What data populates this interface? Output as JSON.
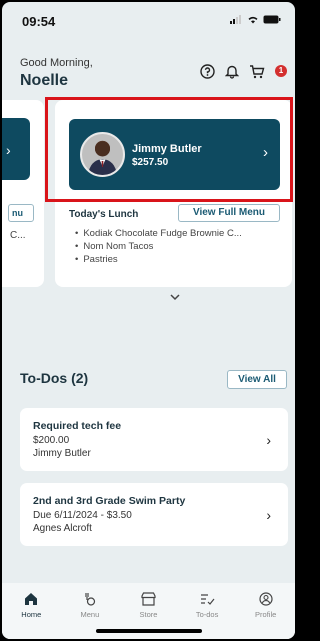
{
  "status": {
    "time": "09:54"
  },
  "header": {
    "greeting": "Good Morning,",
    "user_name": "Noelle",
    "cart_count": "1"
  },
  "side_card": {
    "menu_label": "nu",
    "lunch_preview": "C..."
  },
  "student": {
    "name": "Jimmy Butler",
    "balance": "$257.50"
  },
  "lunch": {
    "title": "Today's Lunch",
    "view_full_label": "View Full Menu",
    "items": [
      "Kodiak Chocolate Fudge Brownie C...",
      "Nom Nom Tacos",
      "Pastries"
    ]
  },
  "todos": {
    "title": "To-Dos (2)",
    "view_all_label": "View All",
    "items": [
      {
        "title": "Required tech fee",
        "line2": "$200.00",
        "line3": "Jimmy Butler"
      },
      {
        "title": "2nd and 3rd Grade Swim Party",
        "line2": "Due 6/11/2024 - $3.50",
        "line3": "Agnes Alcroft"
      }
    ]
  },
  "tabs": [
    {
      "label": "Home",
      "icon": "home-icon"
    },
    {
      "label": "Menu",
      "icon": "menu-icon"
    },
    {
      "label": "Store",
      "icon": "store-icon"
    },
    {
      "label": "To-dos",
      "icon": "todos-icon"
    },
    {
      "label": "Profile",
      "icon": "profile-icon"
    }
  ]
}
